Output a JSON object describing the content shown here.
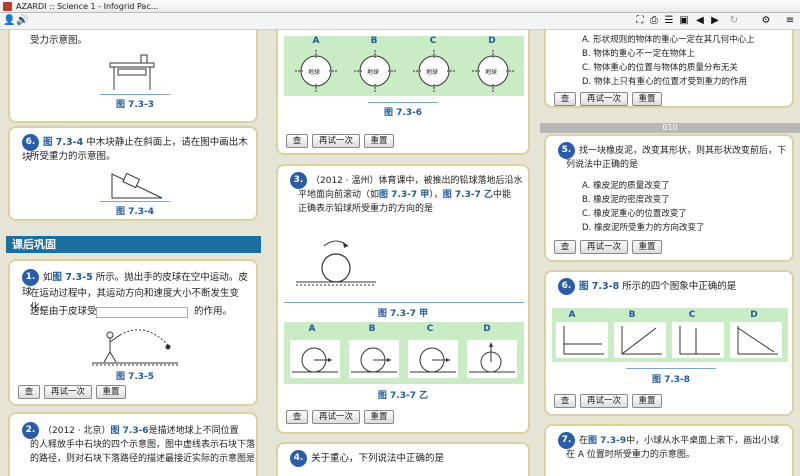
{
  "window": {
    "title": "AZARDI :: Science 1 - Infogrid Pac..."
  },
  "colors": {
    "accent": "#1b6fa0",
    "number_badge": "#2a5da8",
    "figure_caption": "#1f5a9e",
    "card_border": "#d9d1a2",
    "figure_bg": "#c9ecc4"
  },
  "buttons": {
    "check": "查",
    "retry": "再试一次",
    "reset": "重置"
  },
  "col1": {
    "top_text": "受力示意图。",
    "fig_733": "图 7.3-3",
    "q6": {
      "num": "6.",
      "ref": "图 7.3-4",
      "text_a": "中木块静止在斜面上，请在图中画出木块",
      "text_b": "所受重力的示意图。"
    },
    "fig_734": "图 7.3-4",
    "section": "课后巩固",
    "q1": {
      "num": "1.",
      "pre": "如",
      "ref": "图 7.3-5",
      "text_a": "所示。抛出手的皮球在空中运动。皮球",
      "text_b": "在运动过程中，其运动方向和速度大小不断发生变 化。",
      "text_c": "这是由于皮球受",
      "text_d": "的作用。"
    },
    "fig_735": "图 7.3-5",
    "q2": {
      "num": "2.",
      "pre": "（2012 · 北京）",
      "ref": "图 7.3-6",
      "text_a": "是描述地球上不同位置",
      "text_b": "的人释放手中石块的四个示意图，图中虚线表示石块下落",
      "text_c": "的路径，则对石块下落路径的描述最接近实际的示意图是"
    }
  },
  "col2": {
    "fig_labels": [
      "A",
      "B",
      "C",
      "D"
    ],
    "earth": "地球",
    "fig_736": "图 7.3-6",
    "q3": {
      "num": "3.",
      "text_a": "（2012 · 温州）体育课中，被推出的铅球落地后沿水",
      "text_b": "平地面向前滚动（如",
      "ref1": "图 7.3-7 甲",
      "text_c": "），",
      "ref2": "图 7.3-7 乙",
      "text_d": "中能",
      "text_e": "正确表示铅球所受重力的方向的是"
    },
    "fig_737a": "图 7.3-7 甲",
    "fig_737b": "图 7.3-7 乙",
    "q4": {
      "num": "4.",
      "text": "关于重心，下列说法中正确的是"
    }
  },
  "col3": {
    "prev_options": [
      "A. 形状规则的物体的重心一定在其几何中心上",
      "B. 物体的重心不一定在物体上",
      "C. 物体重心的位置与物体的质量分布无关",
      "D. 物体上只有重心的位置才受到重力的作用"
    ],
    "separator": "010",
    "q5": {
      "num": "5.",
      "text_a": "找一块橡皮泥，改变其形状，则其形状改变前后，下",
      "text_b": "列说法中正确的是",
      "options": [
        "A. 橡皮泥的质量改变了",
        "B. 橡皮泥的密度改变了",
        "C. 橡皮泥重心的位置改变了",
        "D. 橡皮泥所受重力的方向改变了"
      ]
    },
    "q6": {
      "num": "6.",
      "ref": "图 7.3-8",
      "text": "所示的四个图象中正确的是"
    },
    "graph_labels": [
      "A",
      "B",
      "C",
      "D"
    ],
    "fig_738": "图 7.3-8",
    "q7": {
      "num": "7.",
      "pre": "在",
      "ref": "图 7.3-9",
      "text_a": "中，小球从水平桌面上滚下，画出小球",
      "text_b": "在 A 位置时所受重力的示意图。"
    }
  }
}
